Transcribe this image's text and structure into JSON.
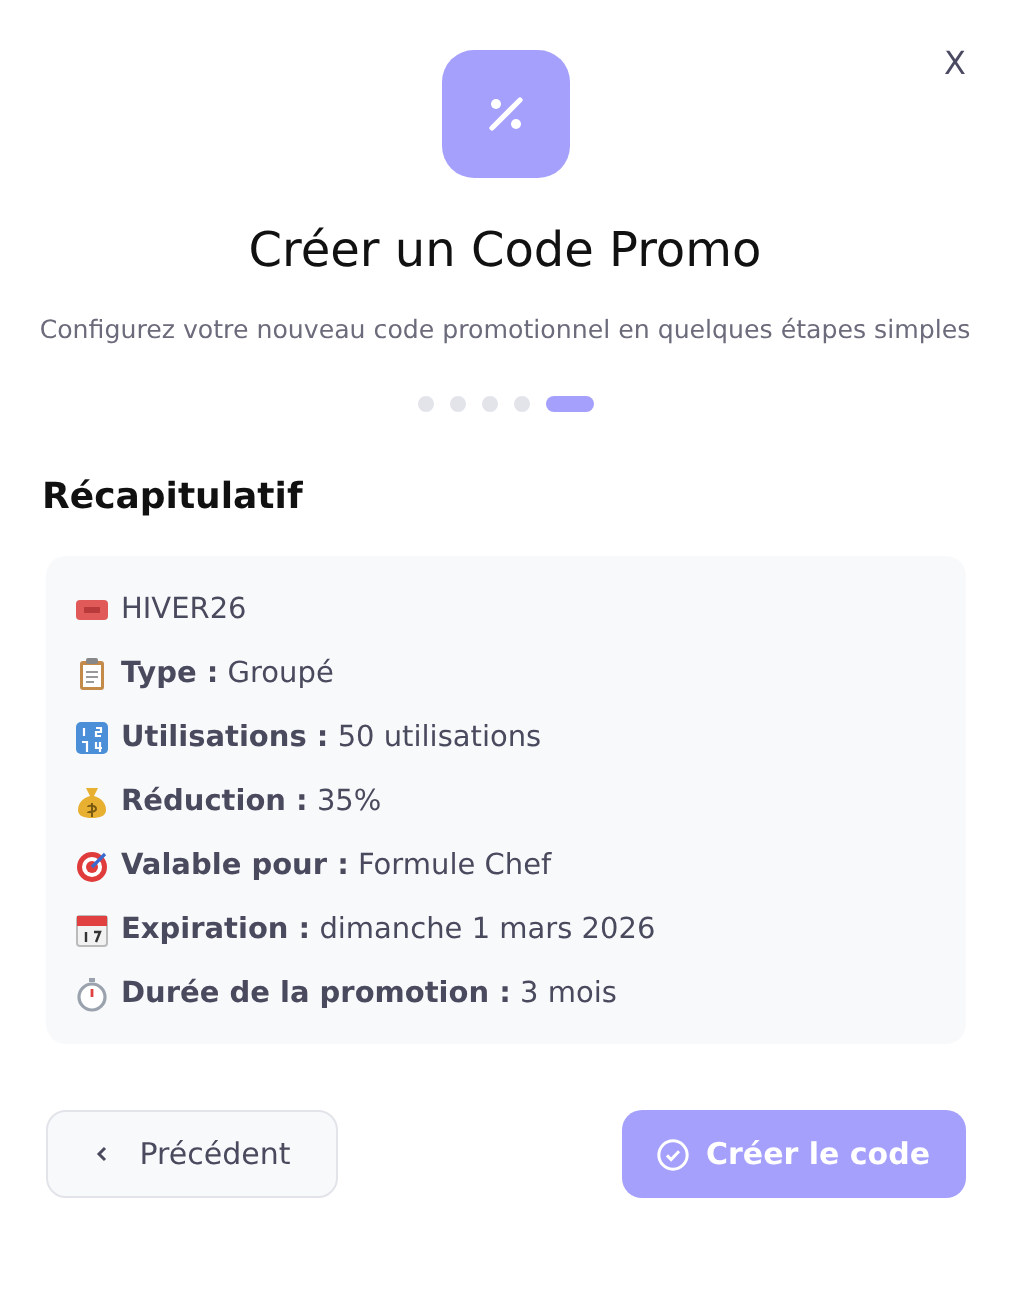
{
  "close_button": {
    "label": "X"
  },
  "title": "Créer un Code Promo",
  "subtitle": "Configurez votre nouveau code promotionnel en quelques étapes simples",
  "steps": [
    {
      "selected": false
    },
    {
      "selected": false
    },
    {
      "selected": false
    },
    {
      "selected": false
    },
    {
      "selected": true
    }
  ],
  "summary": {
    "heading": "Récapitulatif",
    "rows": [
      {
        "kind": "ticket",
        "value": "HIVER26"
      },
      {
        "kind": "clipboard",
        "label": "Type :",
        "value": "Groupé"
      },
      {
        "kind": "numbers",
        "label": "Utilisations :",
        "value": "50 utilisations"
      },
      {
        "kind": "moneybag",
        "label": "Réduction :",
        "value": "35%"
      },
      {
        "kind": "target",
        "label": "Valable pour :",
        "value": "Formule Chef"
      },
      {
        "kind": "calendar",
        "label": "Expiration :",
        "value": "dimanche 1 mars 2026"
      },
      {
        "kind": "stopwatch",
        "label": "Durée de la promotion :",
        "value": "3 mois"
      }
    ]
  },
  "buttons": {
    "previous": "Précédent",
    "create": "Créer le code"
  }
}
